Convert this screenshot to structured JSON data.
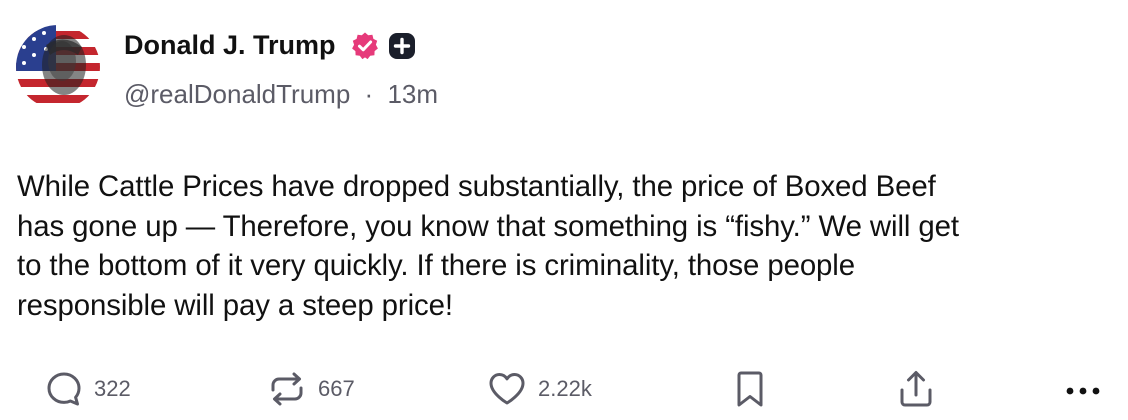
{
  "author": {
    "name": "Donald J. Trump",
    "handle": "@realDonaldTrump",
    "separator": "·",
    "time": "13m"
  },
  "badges": {
    "verified_icon": "verified-badge-icon",
    "plus_icon": "plus-badge-icon",
    "verified_color": "#e63a7a"
  },
  "post": {
    "lines": [
      "While Cattle Prices have dropped substantially, the price of Boxed Beef",
      "has gone up — Therefore, you know that something is “fishy.” We will get",
      "to the bottom of it very quickly. If there is criminality, those people",
      "responsible will pay a steep price!"
    ]
  },
  "actions": {
    "reply_count": "322",
    "repost_count": "667",
    "like_count": "2.22k",
    "icons": [
      "reply-icon",
      "repost-icon",
      "like-icon",
      "bookmark-icon",
      "share-icon",
      "more-icon"
    ]
  },
  "colors": {
    "text": "#111111",
    "muted": "#5b5b66",
    "background": "#ffffff"
  }
}
